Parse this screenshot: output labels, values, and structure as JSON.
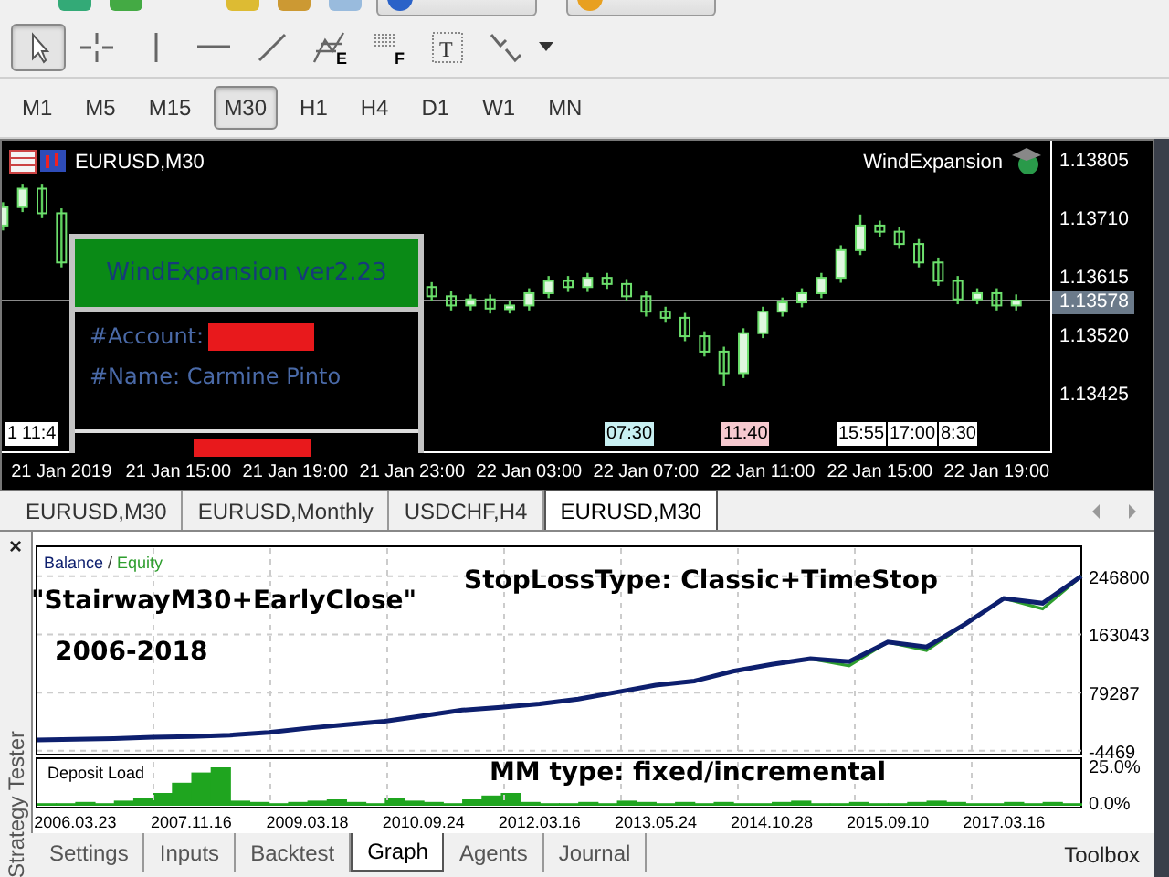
{
  "top_toolbar": {
    "buttons": [
      {
        "kind": "auto_trading"
      },
      {
        "kind": "new_order"
      }
    ]
  },
  "drawing_tools": [
    {
      "kind": "cursor",
      "selected": true
    },
    {
      "kind": "crosshair",
      "selected": false
    },
    {
      "kind": "vline",
      "selected": false
    },
    {
      "kind": "hline",
      "selected": false
    },
    {
      "kind": "trendline",
      "selected": false
    },
    {
      "kind": "fibo",
      "letter": "E",
      "selected": false
    },
    {
      "kind": "grid",
      "letter": "F",
      "selected": false
    },
    {
      "kind": "text",
      "letter": "T",
      "selected": false
    },
    {
      "kind": "arrows",
      "selected": false
    }
  ],
  "timeframes": [
    {
      "label": "M1",
      "selected": false
    },
    {
      "label": "M5",
      "selected": false
    },
    {
      "label": "M15",
      "selected": false
    },
    {
      "label": "M30",
      "selected": true
    },
    {
      "label": "H1",
      "selected": false
    },
    {
      "label": "H4",
      "selected": false
    },
    {
      "label": "D1",
      "selected": false
    },
    {
      "label": "W1",
      "selected": false
    },
    {
      "label": "MN",
      "selected": false
    }
  ],
  "chart": {
    "title": "EURUSD,M30",
    "expert": "WindExpansion",
    "chart_data": {
      "type": "candlestick",
      "ylim": [
        1.1333,
        1.13838
      ],
      "yticks": [
        {
          "value": 1.13805,
          "label": "1.13805"
        },
        {
          "value": 1.1371,
          "label": "1.13710"
        },
        {
          "value": 1.13615,
          "label": "1.13615"
        },
        {
          "value": 1.1352,
          "label": "1.13520"
        },
        {
          "value": 1.13425,
          "label": "1.13425"
        }
      ],
      "ref_lines": [
        {
          "axis": "y",
          "value": 1.13578,
          "label": "1.13578"
        }
      ],
      "categories": [
        null,
        null,
        null,
        "21 Jan 2019",
        null,
        null,
        null,
        null,
        null,
        "21 Jan 15:00",
        null,
        null,
        null,
        null,
        null,
        "21 Jan 19:00",
        null,
        null,
        null,
        null,
        null,
        "21 Jan 23:00",
        null,
        null,
        null,
        null,
        null,
        "22 Jan 03:00",
        null,
        null,
        null,
        null,
        null,
        "22 Jan 07:00",
        null,
        null,
        null,
        null,
        null,
        "22 Jan 11:00",
        null,
        null,
        null,
        null,
        null,
        "22 Jan 15:00",
        null,
        null,
        null,
        null,
        null,
        "22 Jan 19:00",
        null
      ],
      "ohlc": [
        [
          1.137,
          1.13738,
          1.13692,
          1.1373
        ],
        [
          1.1373,
          1.13768,
          1.13722,
          1.1376
        ],
        [
          1.1376,
          1.13768,
          1.13712,
          1.1372
        ],
        [
          1.1372,
          1.13728,
          1.13632,
          1.1364
        ],
        null,
        null,
        null,
        null,
        null,
        null,
        null,
        null,
        null,
        null,
        null,
        null,
        null,
        null,
        null,
        null,
        null,
        null,
        [
          1.136,
          1.13608,
          1.13577,
          1.13585
        ],
        [
          1.13585,
          1.13593,
          1.13562,
          1.1357
        ],
        [
          1.1357,
          1.13588,
          1.13562,
          1.1358
        ],
        [
          1.1358,
          1.13588,
          1.13557,
          1.13565
        ],
        [
          1.13565,
          1.13578,
          1.13557,
          1.1357
        ],
        [
          1.1357,
          1.13598,
          1.13562,
          1.1359
        ],
        [
          1.1359,
          1.13618,
          1.13582,
          1.1361
        ],
        [
          1.1361,
          1.13618,
          1.13592,
          1.136
        ],
        [
          1.136,
          1.13623,
          1.13592,
          1.13615
        ],
        [
          1.13615,
          1.13623,
          1.13597,
          1.13605
        ],
        [
          1.13605,
          1.13613,
          1.13577,
          1.13585
        ],
        [
          1.13585,
          1.13593,
          1.13552,
          1.1356
        ],
        [
          1.1356,
          1.13568,
          1.13542,
          1.1355
        ],
        [
          1.1355,
          1.13558,
          1.13512,
          1.1352
        ],
        [
          1.1352,
          1.13528,
          1.13487,
          1.13495
        ],
        [
          1.13495,
          1.13503,
          1.1344,
          1.1346
        ],
        [
          1.1346,
          1.13533,
          1.13452,
          1.13525
        ],
        [
          1.13525,
          1.13568,
          1.13517,
          1.1356
        ],
        [
          1.1356,
          1.13583,
          1.13552,
          1.13575
        ],
        [
          1.13575,
          1.13598,
          1.13567,
          1.1359
        ],
        [
          1.1359,
          1.13623,
          1.13582,
          1.13615
        ],
        [
          1.13615,
          1.13668,
          1.13607,
          1.1366
        ],
        [
          1.1366,
          1.13718,
          1.13652,
          1.137
        ],
        [
          1.137,
          1.13708,
          1.13682,
          1.1369
        ],
        [
          1.1369,
          1.13698,
          1.13662,
          1.1367
        ],
        [
          1.1367,
          1.13678,
          1.13632,
          1.1364
        ],
        [
          1.1364,
          1.13648,
          1.13602,
          1.1361
        ],
        [
          1.1361,
          1.13618,
          1.13572,
          1.1358
        ],
        [
          1.1358,
          1.13598,
          1.13572,
          1.1359
        ],
        [
          1.1359,
          1.13598,
          1.13562,
          1.1357
        ],
        [
          1.1357,
          1.13588,
          1.13562,
          1.13578
        ]
      ]
    },
    "markers": [
      {
        "text": "1",
        "color": "#ffffff"
      },
      {
        "text": "11:4",
        "color": "#ffffff"
      },
      {
        "text": "07:30",
        "color": "#c8f0f2"
      },
      {
        "text": "11:40",
        "color": "#f6c9cf"
      },
      {
        "text": "15:55",
        "color": "#ffffff"
      },
      {
        "text": "17:00",
        "color": "#ffffff"
      },
      {
        "text": "8:30",
        "color": "#ffffff"
      }
    ],
    "panel": {
      "title": "WindExpansion ver2.23",
      "account": "#Account:",
      "name": "#Name: Carmine Pinto"
    }
  },
  "chart_tabs": [
    {
      "label": "EURUSD,M30",
      "selected": false
    },
    {
      "label": "EURUSD,Monthly",
      "selected": false
    },
    {
      "label": "USDCHF,H4",
      "selected": false
    },
    {
      "label": "EURUSD,M30",
      "selected": true
    }
  ],
  "tester": {
    "title": "Strategy Tester",
    "close": "×",
    "legend_separator": "/",
    "notes": [
      "\"StairwayM30+EarlyClose\"",
      "2006-2018",
      "StopLossType: Classic+TimeStop",
      "MM type: fixed/incremental"
    ],
    "chart_data": {
      "type": "line",
      "categories": [
        null,
        "2006.03.23",
        null,
        null,
        "2007.11.16",
        null,
        null,
        "2009.03.18",
        null,
        null,
        "2010.09.24",
        null,
        null,
        "2012.03.16",
        null,
        null,
        "2013.05.24",
        null,
        null,
        "2014.10.28",
        null,
        null,
        "2015.09.10",
        null,
        null,
        "2017.03.16",
        null,
        null
      ],
      "series": [
        {
          "name": "Balance",
          "color": "#0d1f6e",
          "values": [
            11000,
            12000,
            13000,
            15000,
            16000,
            18000,
            22000,
            28000,
            33000,
            38000,
            46000,
            54000,
            58000,
            63000,
            70000,
            80000,
            90000,
            96000,
            110000,
            120000,
            128000,
            124000,
            152000,
            145000,
            178000,
            215000,
            208000,
            247000
          ]
        },
        {
          "name": "Equity",
          "color": "#2e9e2e",
          "values": [
            null,
            null,
            null,
            null,
            null,
            null,
            null,
            null,
            null,
            null,
            null,
            null,
            null,
            null,
            null,
            null,
            null,
            null,
            null,
            null,
            128000,
            118000,
            152000,
            140000,
            178000,
            215000,
            200000,
            247000
          ]
        }
      ],
      "ylim": [
        -10000,
        290000
      ],
      "yticks": [
        -4469,
        79287,
        163043,
        246800
      ],
      "grid": true
    },
    "deposit_label": "Deposit Load",
    "deposit_ticks": [
      "25.0%",
      "0.0%"
    ],
    "tabs": [
      {
        "label": "Settings",
        "selected": false
      },
      {
        "label": "Inputs",
        "selected": false
      },
      {
        "label": "Backtest",
        "selected": false
      },
      {
        "label": "Graph",
        "selected": true
      },
      {
        "label": "Agents",
        "selected": false
      },
      {
        "label": "Journal",
        "selected": false
      }
    ],
    "toolbox": "Toolbox"
  }
}
